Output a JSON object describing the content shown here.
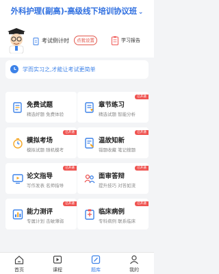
{
  "header": {
    "title": "外科护理(副高)-高级线下培训协议班"
  },
  "hero": {
    "timer_label": "考试倒计时",
    "timer_button": "点我设置",
    "report_label": "学习报告"
  },
  "tip": {
    "text": "学而实习之,才能让考试更简单"
  },
  "cards": [
    {
      "title": "免费试题",
      "subtitle": "精选好题 免费体验",
      "badge": ""
    },
    {
      "title": "章节练习",
      "subtitle": "精选试题 智能分析",
      "badge": "已开通"
    },
    {
      "title": "模拟考场",
      "subtitle": "模拟试题 随机模考",
      "badge": "已开通"
    },
    {
      "title": "温故知新",
      "subtitle": "错题收藏 笔记搜题",
      "badge": "已开通"
    },
    {
      "title": "论文指导",
      "subtitle": "写作发表 名师指导",
      "badge": "已开通"
    },
    {
      "title": "面审答辩",
      "subtitle": "提升技巧 对答如流",
      "badge": "已开通"
    },
    {
      "title": "能力测评",
      "subtitle": "专属计划 击破薄弱",
      "badge": "已开通"
    },
    {
      "title": "临床病例",
      "subtitle": "专科病例 联系临床",
      "badge": "已开通"
    }
  ],
  "tabs": [
    {
      "label": "首页",
      "icon": "home-icon"
    },
    {
      "label": "课程",
      "icon": "video-icon"
    },
    {
      "label": "题库",
      "icon": "edit-icon"
    },
    {
      "label": "我的",
      "icon": "user-icon"
    }
  ],
  "active_tab": "题库",
  "colors": {
    "accent": "#3d82e8",
    "badge": "#ef5350",
    "title": "#2f6fe0"
  }
}
